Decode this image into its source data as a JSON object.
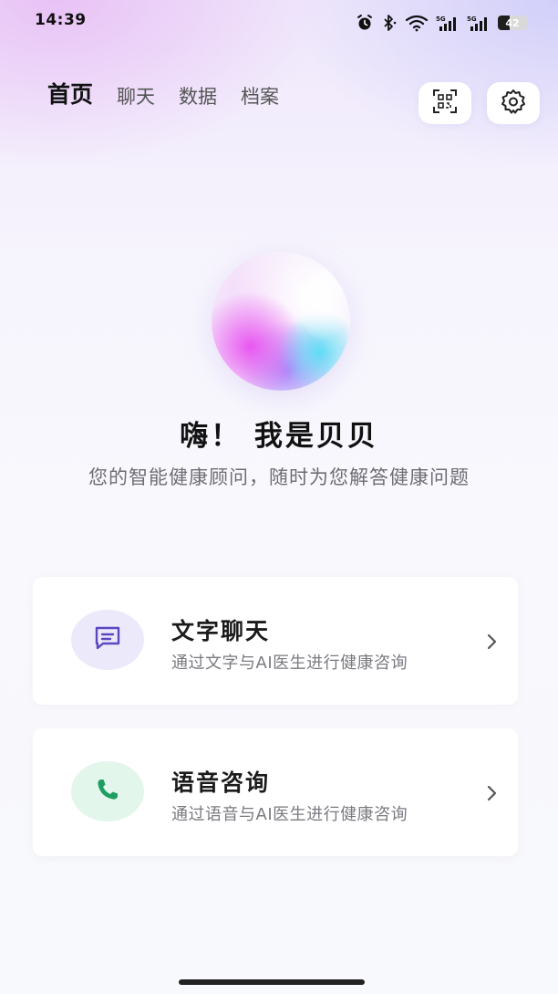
{
  "status_bar": {
    "time": "14:39",
    "battery_level": "42",
    "battery_fraction": 0.42,
    "network_1": "5G",
    "network_2": "5G",
    "icons": [
      "alarm-icon",
      "bluetooth-icon",
      "wifi-icon",
      "signal-5g-icon",
      "signal-5g-icon",
      "battery-icon"
    ]
  },
  "nav": {
    "tabs": [
      {
        "label": "首页",
        "active": true
      },
      {
        "label": "聊天",
        "active": false
      },
      {
        "label": "数据",
        "active": false
      },
      {
        "label": "档案",
        "active": false
      }
    ],
    "scan_icon": "scan-qr-icon",
    "settings_icon": "gear-icon"
  },
  "hero": {
    "title": "嗨！ 我是贝贝",
    "subtitle": "您的智能健康顾问，随时为您解答健康问题"
  },
  "options": [
    {
      "title": "文字聊天",
      "description": "通过文字与AI医生进行健康咨询",
      "icon": "chat-message-icon",
      "icon_color": "#5a48c2",
      "icon_bg": "#ece9fb"
    },
    {
      "title": "语音咨询",
      "description": "通过语音与AI医生进行健康咨询",
      "icon": "phone-icon",
      "icon_color": "#1f9e62",
      "icon_bg": "#e3f6ec"
    }
  ],
  "colors": {
    "accent_purple": "#5a48c2",
    "accent_green": "#1f9e62",
    "text_primary": "#111111",
    "text_secondary": "#6d6d73"
  }
}
